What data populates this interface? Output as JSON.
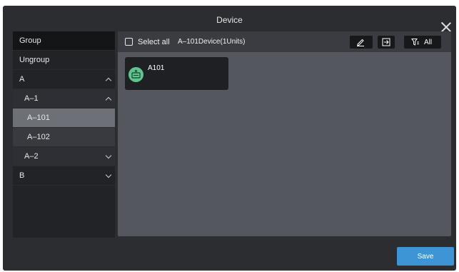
{
  "dialog": {
    "title": "Device"
  },
  "sidebar": {
    "items": [
      {
        "label": "Group"
      },
      {
        "label": "Ungroup"
      },
      {
        "label": "A"
      },
      {
        "label": "A–1"
      },
      {
        "label": "A–101"
      },
      {
        "label": "A–102"
      },
      {
        "label": "A–2"
      },
      {
        "label": "B"
      }
    ]
  },
  "toolbar": {
    "select_all_label": "Select all",
    "device_count": "A–101Device(1Units)",
    "filter_label": "All",
    "icons": [
      "edit-icon",
      "move-icon",
      "filter-icon"
    ]
  },
  "devices": [
    {
      "name": "A101",
      "icon": "device-icon",
      "color": "#5fc48f"
    }
  ],
  "footer": {
    "save_label": "Save"
  },
  "colors": {
    "accent": "#3d95d6",
    "device_green": "#5fc48f"
  }
}
